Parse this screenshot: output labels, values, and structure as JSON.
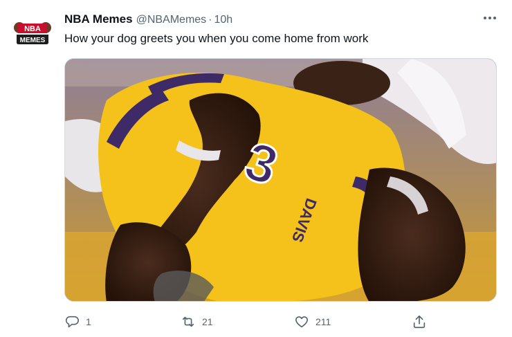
{
  "tweet": {
    "author_name": "NBA Memes",
    "author_handle": "@NBAMemes",
    "separator": "·",
    "time": "10h",
    "text": "How your dog greets you when you come home from work",
    "avatar_text_top": "NBA",
    "avatar_text_bottom": "MEMES",
    "media": {
      "jersey_number": "3",
      "jersey_name": "DAVIS"
    }
  },
  "actions": {
    "reply_count": "1",
    "retweet_count": "21",
    "like_count": "211"
  },
  "colors": {
    "jersey_yellow": "#f4c21a",
    "jersey_purple": "#3e2a66",
    "secondary_text": "#536471",
    "background": "#ffffff"
  },
  "icons": {
    "more": "more-icon",
    "reply": "reply-icon",
    "retweet": "retweet-icon",
    "like": "heart-icon",
    "share": "share-icon"
  }
}
